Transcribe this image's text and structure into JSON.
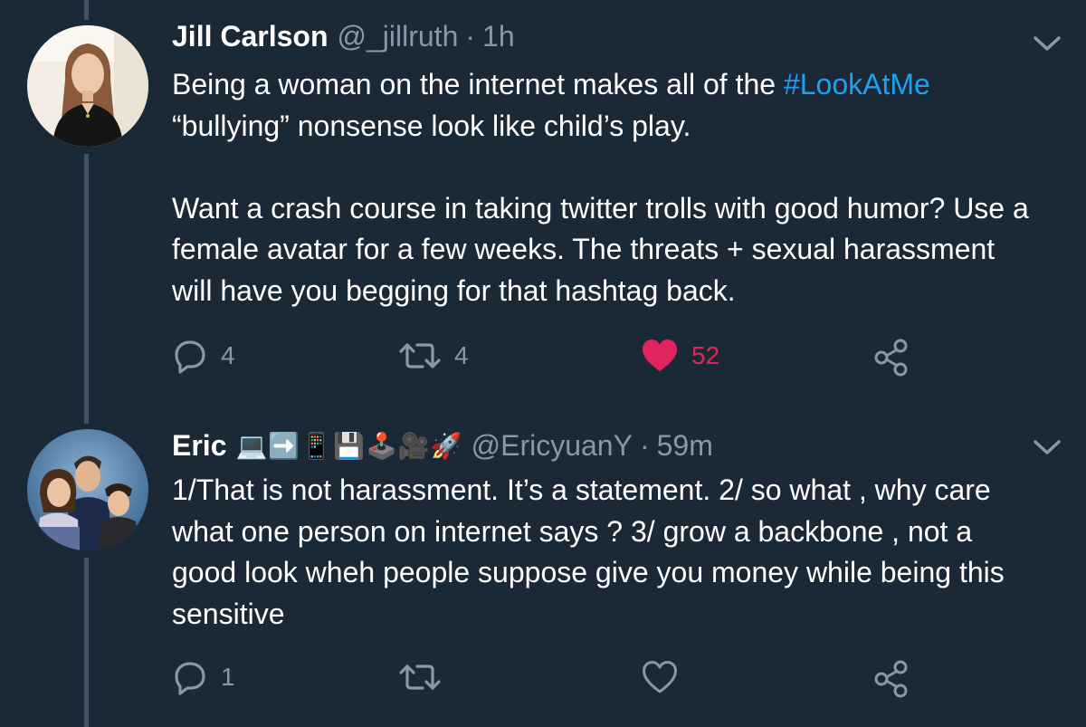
{
  "tweets": [
    {
      "name": "Jill Carlson",
      "handle": "@_jillruth",
      "separator": "·",
      "time": "1h",
      "text_line1_pre": "Being a woman on the internet makes all of the ",
      "hashtag": "#LookAtMe",
      "text_line2": "“bullying” nonsense look like child’s play.",
      "text_para2": "Want a crash course in taking twitter trolls with good humor? Use a female avatar for a few weeks. The threats + sexual harassment will have you begging for that hashtag back.",
      "replies": "4",
      "retweets": "4",
      "likes": "52",
      "liked": true,
      "avatar_icon": "woman-portrait-avatar"
    },
    {
      "name": "Eric",
      "name_emoji": [
        "💻",
        "➡️",
        "📱",
        "💾",
        "🕹️",
        "🎥",
        "🚀"
      ],
      "handle": "@EricyuanY",
      "separator": "·",
      "time": "59m",
      "text": "1/That  is not harassment. It’s a statement. 2/ so what , why care what one person on internet says ? 3/ grow a backbone , not a good look wheh people suppose give you money while being this sensitive",
      "replies": "1",
      "liked": false,
      "avatar_icon": "family-photo-avatar"
    }
  ],
  "colors": {
    "background": "#1b2836",
    "text": "#ffffff",
    "secondary": "#8899a6",
    "link": "#1da1f2",
    "like": "#e0245e",
    "thread_line": "#3d5466"
  }
}
